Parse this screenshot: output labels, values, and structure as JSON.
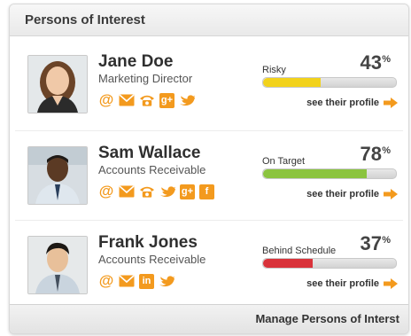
{
  "widget": {
    "title": "Persons of Interest",
    "footer_link": "Manage Persons of Interst"
  },
  "colors": {
    "accent_orange": "#f39a1e",
    "risky_yellow": "#f2d21b",
    "on_target_green": "#8bc43f",
    "behind_red": "#d9323a"
  },
  "persons": [
    {
      "name": "Jane Doe",
      "role": "Marketing Director",
      "status": "Risky",
      "percent": "43",
      "percent_sign": "%",
      "progress": 0.43,
      "bar_color": "#f2d21b",
      "profile_link": "see their profile",
      "icons": [
        "at-icon",
        "email-icon",
        "phone-icon",
        "google-plus-icon",
        "twitter-icon"
      ]
    },
    {
      "name": "Sam Wallace",
      "role": "Accounts Receivable",
      "status": "On Target",
      "percent": "78",
      "percent_sign": "%",
      "progress": 0.78,
      "bar_color": "#8bc43f",
      "profile_link": "see their profile",
      "icons": [
        "at-icon",
        "email-icon",
        "phone-icon",
        "twitter-icon",
        "google-plus-icon",
        "facebook-icon"
      ]
    },
    {
      "name": "Frank Jones",
      "role": "Accounts Receivable",
      "status": "Behind Schedule",
      "percent": "37",
      "percent_sign": "%",
      "progress": 0.37,
      "bar_color": "#d9323a",
      "profile_link": "see their profile",
      "icons": [
        "at-icon",
        "email-icon",
        "linkedin-icon",
        "twitter-icon"
      ]
    }
  ],
  "icon_glyphs": {
    "google_plus": "g+",
    "facebook": "f",
    "linkedin": "in"
  }
}
